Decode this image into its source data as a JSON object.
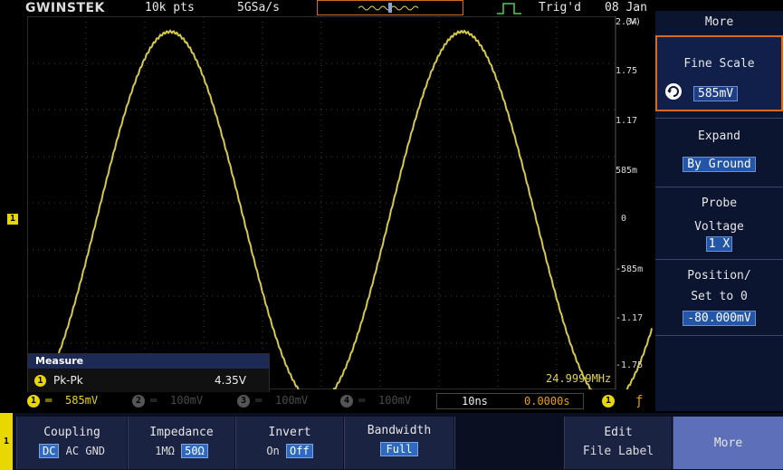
{
  "topbar": {
    "brand": "GWINSTEK",
    "memory": "10k pts",
    "sample_rate": "5GSa/s",
    "trigger_status": "Trig'd",
    "date": "08 Jan"
  },
  "grid": {
    "unit": "(V)",
    "scale_labels": [
      "2.34",
      "1.75",
      "1.17",
      "585m",
      "0",
      "-585m",
      "-1.17",
      "-1.75"
    ],
    "frequency": "24.9999MHz"
  },
  "ch1_marker": "1",
  "measure": {
    "title": "Measure",
    "channel": "1",
    "name": "Pk-Pk",
    "value": "4.35V"
  },
  "channels": [
    {
      "num": "1",
      "scale": "585mV",
      "color": "#e8d700"
    },
    {
      "num": "2",
      "scale": "100mV",
      "color": "#555555"
    },
    {
      "num": "3",
      "scale": "100mV",
      "color": "#555555"
    },
    {
      "num": "4",
      "scale": "100mV",
      "color": "#555555"
    }
  ],
  "timebase": {
    "time_div": "10ns",
    "position": "0.0000s"
  },
  "trigger": {
    "source": "1",
    "slope_symbol": "ƒ"
  },
  "right_menu": {
    "title": "More",
    "fine_scale_label": "Fine Scale",
    "fine_scale_value": "585mV",
    "expand_label": "Expand",
    "expand_value": "By Ground",
    "probe_label": "Probe",
    "probe_type": "Voltage",
    "probe_value": "1 X",
    "position_label": "Position/",
    "position_label2": "Set to 0",
    "position_value": "-80.000mV"
  },
  "bottom_menu": {
    "channel": "1",
    "coupling_label": "Coupling",
    "coupling_options": [
      "DC",
      "AC",
      "GND"
    ],
    "impedance_label": "Impedance",
    "impedance_options": [
      "1MΩ",
      "50Ω"
    ],
    "invert_label": "Invert",
    "invert_options": [
      "On",
      "Off"
    ],
    "bandwidth_label": "Bandwidth",
    "bandwidth_value": "Full",
    "edit_label": "Edit",
    "edit_label2": "File Label",
    "more_label": "More"
  },
  "colors": {
    "trace": "#e0d44a",
    "ch1": "#e8d700",
    "accent_orange": "#d86a1e",
    "menu_bg": "#0c1530",
    "highlight": "#2356a8"
  }
}
